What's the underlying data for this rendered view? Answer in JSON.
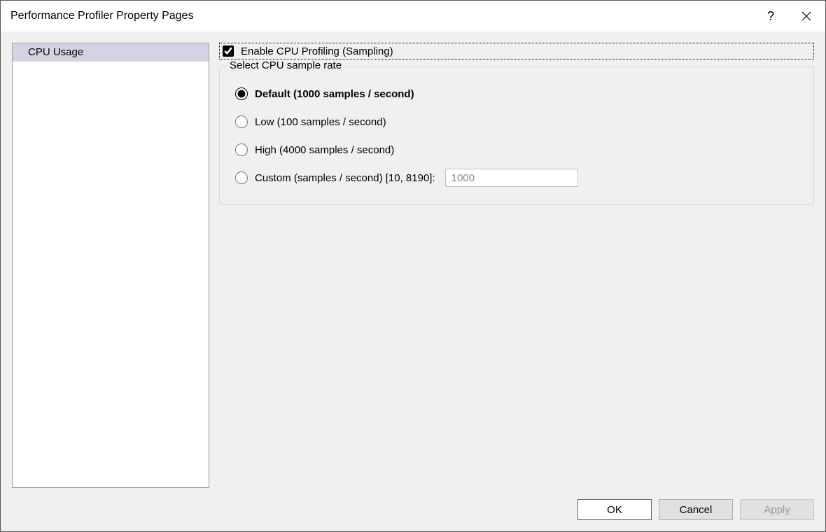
{
  "window": {
    "title": "Performance Profiler Property Pages"
  },
  "nav": {
    "items": [
      {
        "label": "CPU Usage",
        "selected": true
      }
    ]
  },
  "content": {
    "enable_checkbox": {
      "label": "Enable CPU Profiling (Sampling)",
      "checked": true
    },
    "group": {
      "legend": "Select CPU sample rate",
      "options": [
        {
          "id": "default",
          "label": "Default (1000 samples / second)",
          "selected": true
        },
        {
          "id": "low",
          "label": "Low (100 samples / second)",
          "selected": false
        },
        {
          "id": "high",
          "label": "High (4000 samples / second)",
          "selected": false
        },
        {
          "id": "custom",
          "label": "Custom (samples / second) [10, 8190]:",
          "selected": false
        }
      ],
      "custom_value": "1000"
    }
  },
  "buttons": {
    "ok": "OK",
    "cancel": "Cancel",
    "apply": "Apply"
  }
}
